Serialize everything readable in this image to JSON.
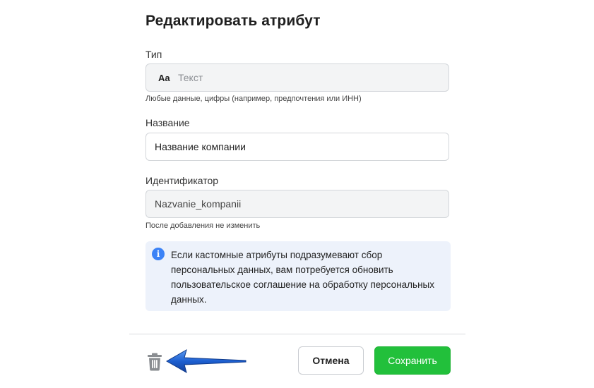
{
  "dialog": {
    "title": "Редактировать атрибут"
  },
  "type_field": {
    "label": "Тип",
    "icon_text": "Aa",
    "value": "Текст",
    "hint": "Любые данные, цифры (например, предпочтения или ИНН)"
  },
  "name_field": {
    "label": "Название",
    "value": "Название компании"
  },
  "id_field": {
    "label": "Идентификатор",
    "value": "Nazvanie_kompanii",
    "hint": "После добавления не изменить"
  },
  "info": {
    "icon": "info-icon",
    "text": "Если кастомные атрибуты подразумевают сбор персональных данных, вам потребуется обновить пользовательское соглашение на обработку персональных данных."
  },
  "footer": {
    "delete_icon": "trash-icon",
    "cancel_label": "Отмена",
    "save_label": "Сохранить"
  },
  "colors": {
    "accent_save": "#22c03b",
    "info_bg": "#edf2fb",
    "info_icon": "#3b82f6",
    "annotation_arrow": "#1d5fd0"
  }
}
